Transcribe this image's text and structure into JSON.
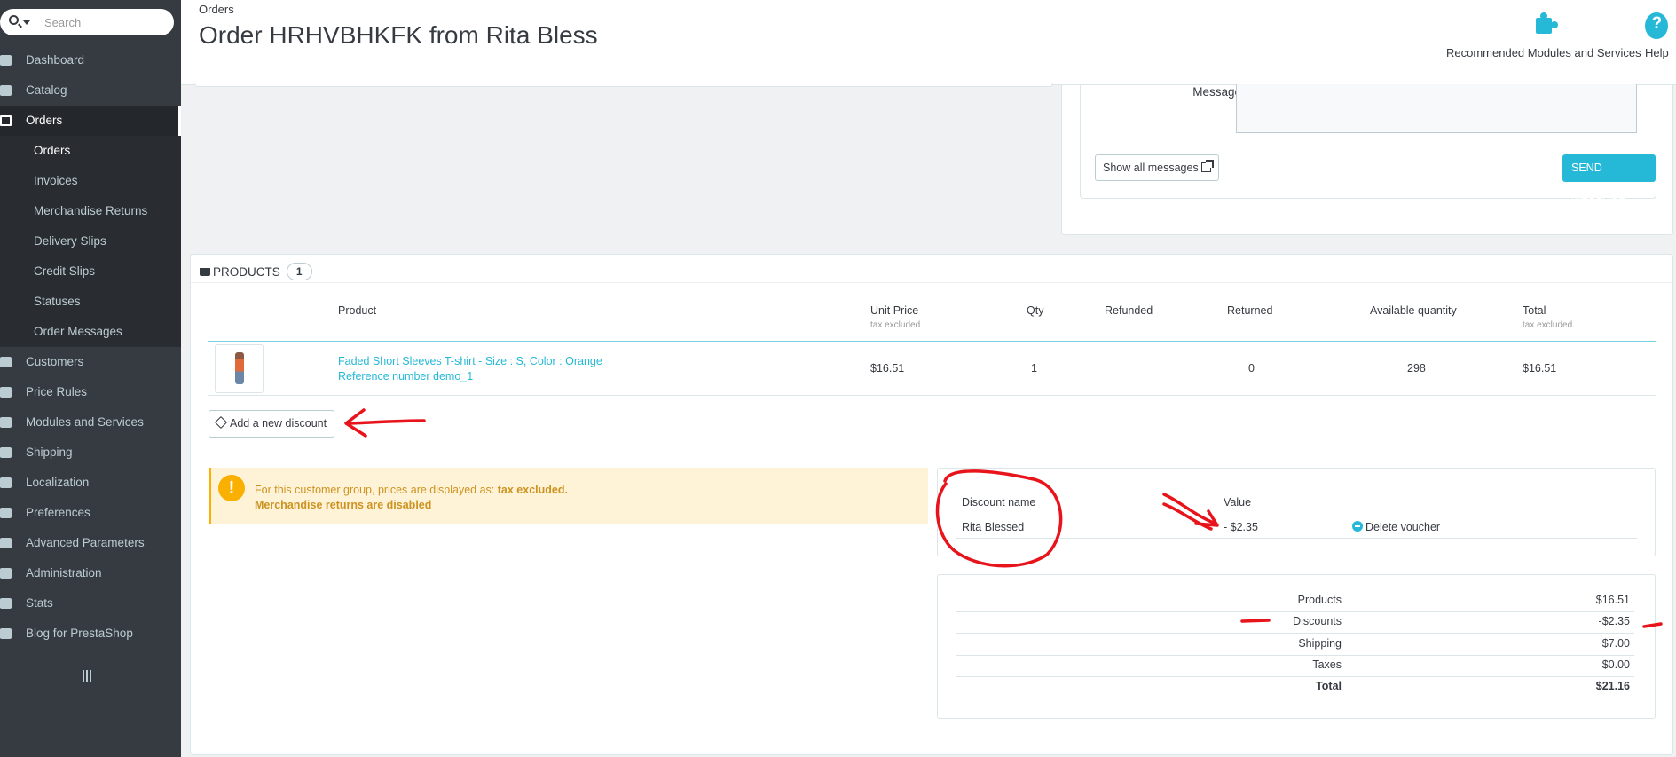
{
  "search": {
    "placeholder": "Search"
  },
  "sidebar": {
    "items": [
      {
        "label": "Dashboard"
      },
      {
        "label": "Catalog"
      },
      {
        "label": "Orders"
      },
      {
        "label": "Customers"
      },
      {
        "label": "Price Rules"
      },
      {
        "label": "Modules and Services"
      },
      {
        "label": "Shipping"
      },
      {
        "label": "Localization"
      },
      {
        "label": "Preferences"
      },
      {
        "label": "Advanced Parameters"
      },
      {
        "label": "Administration"
      },
      {
        "label": "Stats"
      },
      {
        "label": "Blog for PrestaShop"
      }
    ],
    "orders_sub": [
      {
        "label": "Orders"
      },
      {
        "label": "Invoices"
      },
      {
        "label": "Merchandise Returns"
      },
      {
        "label": "Delivery Slips"
      },
      {
        "label": "Credit Slips"
      },
      {
        "label": "Statuses"
      },
      {
        "label": "Order Messages"
      }
    ]
  },
  "header": {
    "breadcrumb": "Orders",
    "title": "Order HRHVBHKFK from Rita Bless",
    "recommended_label": "Recommended Modules and Services",
    "help_label": "Help",
    "help_glyph": "?"
  },
  "messages": {
    "message_label": "Message",
    "show_all_label": "Show all messages",
    "send_label": "SEND MESSAGE"
  },
  "products": {
    "heading": "PRODUCTS",
    "count": "1",
    "columns": {
      "product": "Product",
      "unit_price": "Unit Price",
      "unit_price_sub": "tax excluded.",
      "qty": "Qty",
      "refunded": "Refunded",
      "returned": "Returned",
      "available": "Available quantity",
      "total": "Total",
      "total_sub": "tax excluded."
    },
    "rows": [
      {
        "name": "Faded Short Sleeves T-shirt - Size : S, Color : Orange",
        "reference": "Reference number demo_1",
        "unit_price": "$16.51",
        "qty": "1",
        "refunded": "",
        "returned": "0",
        "available": "298",
        "total": "$16.51"
      }
    ],
    "add_discount_label": "Add a new discount"
  },
  "alert": {
    "line1_prefix": "For this customer group, prices are displayed as:",
    "line1_strong": "tax excluded.",
    "line2": "Merchandise returns are disabled",
    "glyph": "!"
  },
  "discounts": {
    "col_name": "Discount name",
    "col_value": "Value",
    "rows": [
      {
        "name": "Rita Blessed",
        "value": "- $2.35",
        "action": "Delete voucher"
      }
    ]
  },
  "totals": [
    {
      "label": "Products",
      "value": "$16.51"
    },
    {
      "label": "Discounts",
      "value": "-$2.35"
    },
    {
      "label": "Shipping",
      "value": "$7.00"
    },
    {
      "label": "Taxes",
      "value": "$0.00"
    },
    {
      "label": "Total",
      "value": "$21.16"
    }
  ],
  "colors": {
    "accent": "#25b9d7",
    "sidebar": "#363a41",
    "warning": "#fab000",
    "annotation": "#e8141b"
  }
}
